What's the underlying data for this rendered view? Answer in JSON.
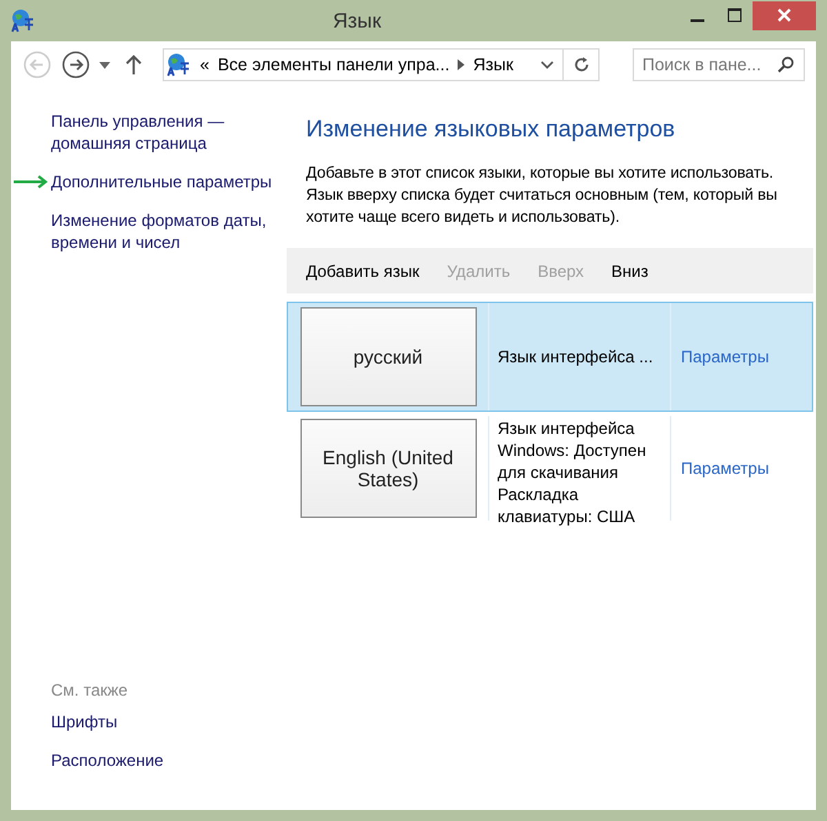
{
  "window": {
    "title": "Язык"
  },
  "nav": {
    "back_disabled": true,
    "forward_disabled": false
  },
  "address": {
    "crumbs": [
      "«",
      "Все элементы панели упра...",
      "Язык"
    ]
  },
  "search": {
    "placeholder": "Поиск в пане..."
  },
  "sidebar": {
    "links": [
      {
        "label": "Панель управления — домашняя страница",
        "marked": false
      },
      {
        "label": "Дополнительные параметры",
        "marked": true
      },
      {
        "label": "Изменение форматов даты, времени и чисел",
        "marked": false
      }
    ],
    "see_also": {
      "title": "См. также",
      "links": [
        "Шрифты",
        "Расположение"
      ]
    }
  },
  "heading": "Изменение языковых параметров",
  "description": "Добавьте в этот список языки, которые вы хотите использовать. Язык вверху списка будет считаться основным (тем, который вы хотите чаще всего видеть и использовать).",
  "actions": [
    {
      "label": "Добавить язык",
      "disabled": false
    },
    {
      "label": "Удалить",
      "disabled": true
    },
    {
      "label": "Вверх",
      "disabled": true
    },
    {
      "label": "Вниз",
      "disabled": false
    }
  ],
  "languages": [
    {
      "name": "русский",
      "info": "Язык интерфейса ...",
      "link": "Параметры",
      "selected": true
    },
    {
      "name": "English (United States)",
      "info": "Язык интерфейса Windows: Доступен для скачивания Раскладка клавиатуры: США",
      "link": "Параметры",
      "selected": false
    }
  ]
}
